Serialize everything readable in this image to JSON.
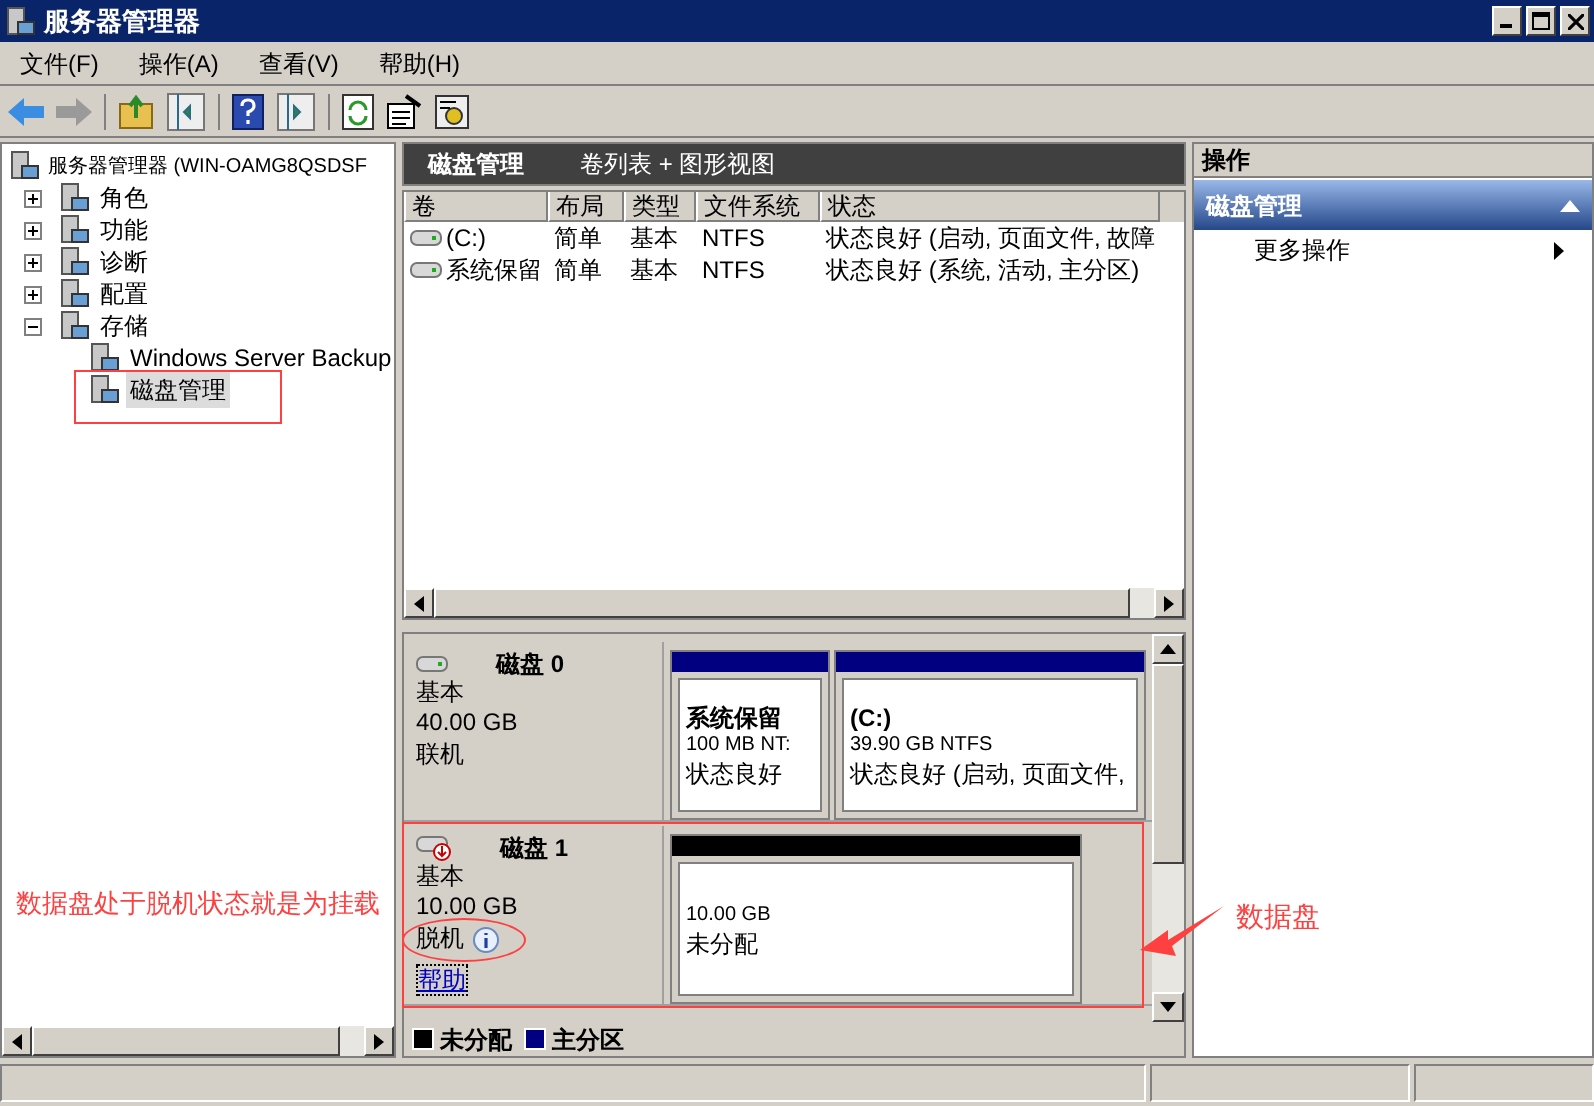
{
  "window": {
    "title": "服务器管理器"
  },
  "menu": [
    {
      "label": "文件(F)"
    },
    {
      "label": "操作(A)"
    },
    {
      "label": "查看(V)"
    },
    {
      "label": "帮助(H)"
    }
  ],
  "tree": {
    "label": "服务器管理器 (WIN-OAMG8QSDSF",
    "children": [
      {
        "label": "角色",
        "expanded": false,
        "selected": false
      },
      {
        "label": "功能",
        "expanded": false,
        "selected": false
      },
      {
        "label": "诊断",
        "expanded": false,
        "selected": false
      },
      {
        "label": "配置",
        "expanded": false,
        "selected": false
      },
      {
        "label": "存储",
        "expanded": true,
        "selected": false,
        "children": [
          {
            "label": "Windows Server Backup",
            "selected": false
          },
          {
            "label": "磁盘管理",
            "selected": true
          }
        ]
      }
    ]
  },
  "center": {
    "title": "磁盘管理",
    "view": "卷列表 + 图形视图",
    "columns": [
      "卷",
      "布局",
      "类型",
      "文件系统",
      "状态"
    ],
    "rows": [
      [
        "(C:)",
        "简单",
        "基本",
        "NTFS",
        "状态良好 (启动, 页面文件, 故障"
      ],
      [
        "系统保留",
        "简单",
        "基本",
        "NTFS",
        "状态良好 (系统, 活动, 主分区)"
      ]
    ],
    "disks": [
      {
        "name": "磁盘 0",
        "type": "基本",
        "size": "40.00 GB",
        "status": "联机",
        "offline": false,
        "partitions": [
          {
            "name": "系统保留",
            "size": "100 MB NT:",
            "status": "状态良好",
            "color": "#000080"
          },
          {
            "name": "(C:)",
            "size": "39.90 GB NTFS",
            "status": "状态良好 (启动, 页面文件,",
            "color": "#000080"
          }
        ]
      },
      {
        "name": "磁盘 1",
        "type": "基本",
        "size": "10.00 GB",
        "status": "脱机",
        "offline": true,
        "help": "帮助",
        "partitions": [
          {
            "size": "10.00 GB",
            "status": "未分配",
            "color": "#000000"
          }
        ]
      }
    ],
    "legend": [
      {
        "label": "未分配",
        "color": "#000000"
      },
      {
        "label": "主分区",
        "color": "#000080"
      }
    ]
  },
  "actions": {
    "title": "操作",
    "section": "磁盘管理",
    "items": [
      "更多操作"
    ]
  },
  "annotations": [
    {
      "kind": "note",
      "text": "数据盘处于脱机状态就是为挂载"
    },
    {
      "kind": "arrow",
      "text": "数据盘"
    }
  ]
}
